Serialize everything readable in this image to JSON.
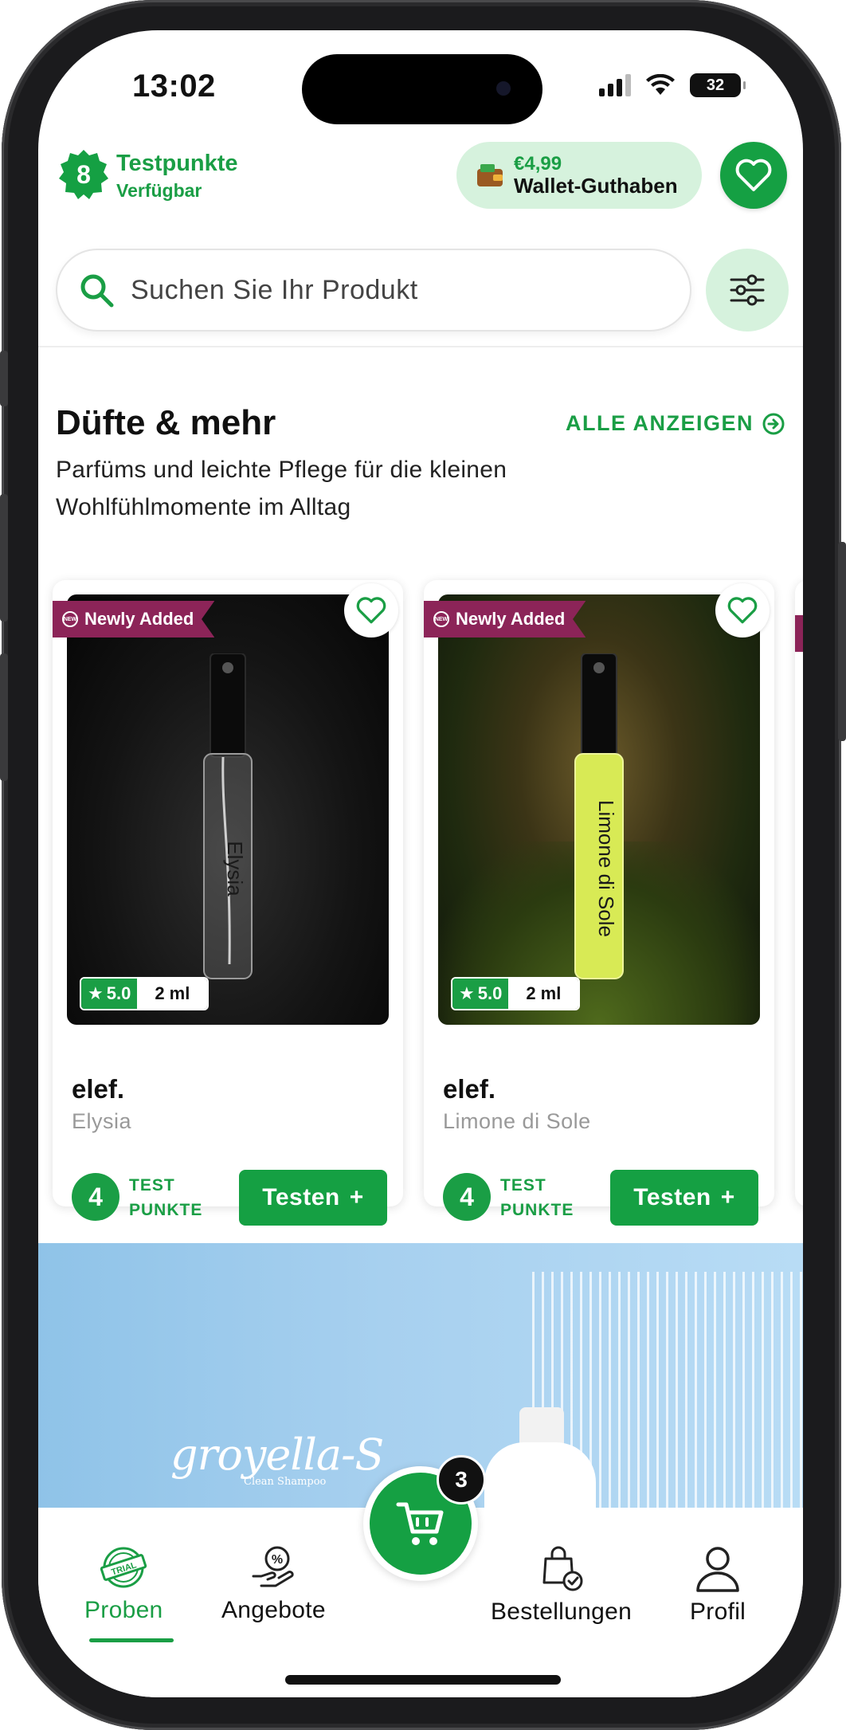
{
  "status_bar": {
    "time": "13:02",
    "battery": "32"
  },
  "header": {
    "points_value": "8",
    "points_title": "Testpunkte",
    "points_subtitle": "Verfügbar",
    "wallet_amount": "€4,99",
    "wallet_label": "Wallet-Guthaben"
  },
  "search": {
    "placeholder": "Suchen Sie Ihr Produkt"
  },
  "section": {
    "title": "Düfte & mehr",
    "see_all": "ALLE ANZEIGEN",
    "description": "Parfüms und leichte Pflege für die kleinen Wohlfühlmomente im Alltag"
  },
  "products": [
    {
      "badge": "Newly Added",
      "rating": "5.0",
      "size": "2 ml",
      "brand": "elef.",
      "name": "Elysia",
      "bottle_label": "Elysia",
      "points": "4",
      "points_label_1": "TEST",
      "points_label_2": "PUNKTE",
      "button": "Testen"
    },
    {
      "badge": "Newly Added",
      "rating": "5.0",
      "size": "2 ml",
      "brand": "elef.",
      "name": "Limone di Sole",
      "bottle_label": "Limone di Sole",
      "points": "4",
      "points_label_1": "TEST",
      "points_label_2": "PUNKTE",
      "button": "Testen"
    }
  ],
  "banner": {
    "logo": "groyella-S",
    "logo_sub": "Clean Shampoo"
  },
  "bottom_nav": {
    "items": [
      {
        "label": "Proben",
        "icon": "trial-stamp-icon",
        "active": true
      },
      {
        "label": "Angebote",
        "icon": "offer-hand-icon",
        "active": false
      },
      {
        "label": "Bestellungen",
        "icon": "shopping-bag-check-icon",
        "active": false
      },
      {
        "label": "Profil",
        "icon": "user-icon",
        "active": false
      }
    ],
    "cart_count": "3"
  },
  "colors": {
    "primary": "#15a043",
    "primary_light": "#d6f2dd",
    "badge": "#8c2458"
  }
}
